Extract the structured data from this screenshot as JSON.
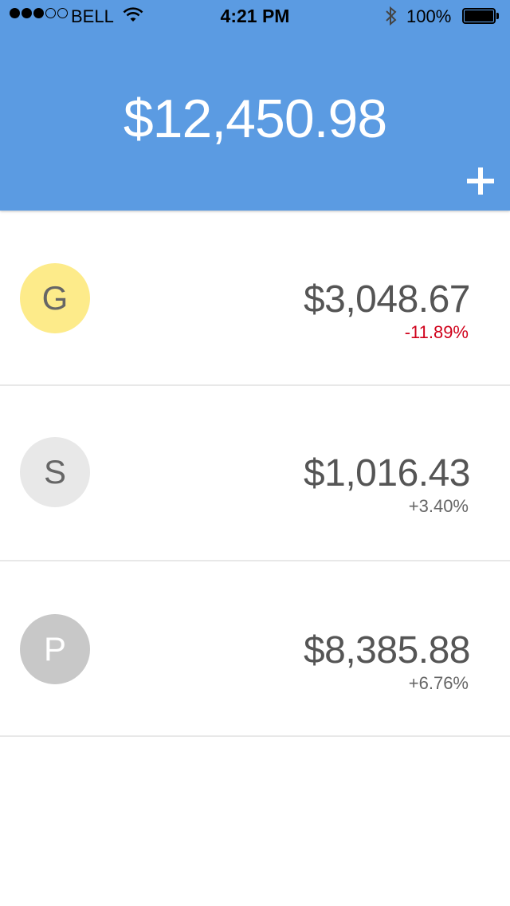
{
  "status_bar": {
    "carrier": "BELL",
    "time": "4:21 PM",
    "battery": "100%",
    "signal_bars_filled": 3,
    "signal_bars_total": 5
  },
  "header": {
    "total": "$12,450.98",
    "background_color": "#5b9be2",
    "add_icon": "plus-icon"
  },
  "accounts": [
    {
      "initial": "G",
      "amount": "$3,048.67",
      "change": "-11.89%",
      "avatar_color": "#fdeb8a",
      "initial_color": "#666666",
      "change_color": "#d0021b"
    },
    {
      "initial": "S",
      "amount": "$1,016.43",
      "change": "+3.40%",
      "avatar_color": "#e8e8e8",
      "initial_color": "#666666",
      "change_color": "#666666"
    },
    {
      "initial": "P",
      "amount": "$8,385.88",
      "change": "+6.76%",
      "avatar_color": "#c8c8c8",
      "initial_color": "#ffffff",
      "change_color": "#666666"
    }
  ]
}
